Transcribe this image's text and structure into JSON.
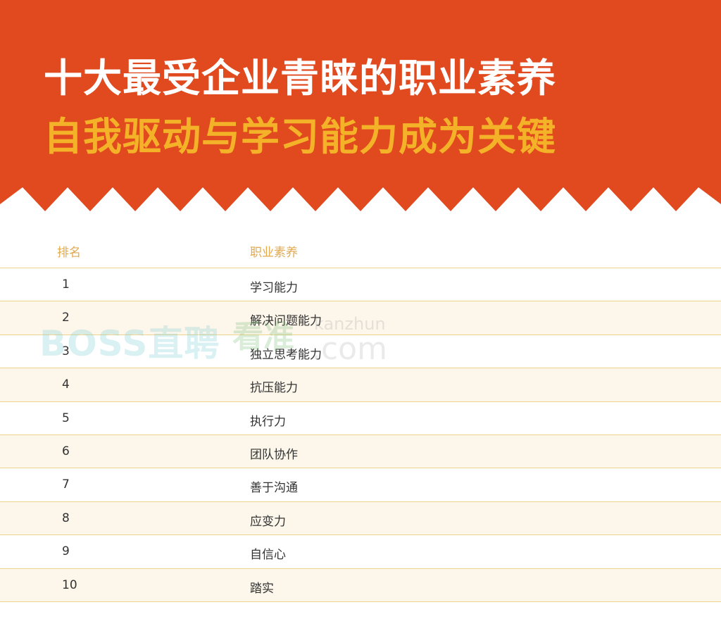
{
  "header": {
    "title_line1": "十大最受企业青睐的职业素养",
    "title_line2": "自我驱动与学习能力成为关键",
    "colors": {
      "banner_bg": "#e14a1f",
      "title_line1": "#ffffff",
      "title_line2": "#f3b228"
    }
  },
  "table": {
    "headers": {
      "rank": "排名",
      "trait": "职业素养"
    },
    "rows": [
      {
        "rank": "1",
        "trait": "学习能力"
      },
      {
        "rank": "2",
        "trait": "解决问题能力"
      },
      {
        "rank": "3",
        "trait": "独立思考能力"
      },
      {
        "rank": "4",
        "trait": "抗压能力"
      },
      {
        "rank": "5",
        "trait": "执行力"
      },
      {
        "rank": "6",
        "trait": "团队协作"
      },
      {
        "rank": "7",
        "trait": "善于沟通"
      },
      {
        "rank": "8",
        "trait": "应变力"
      },
      {
        "rank": "9",
        "trait": "自信心"
      },
      {
        "rank": "10",
        "trait": "踏实"
      }
    ],
    "colors": {
      "header_text": "#e2a94f",
      "row_alt_bg": "#fdf6ea",
      "divider": "#ecd58a",
      "cell_text": "#333333"
    }
  },
  "watermark": {
    "brand": "BOSS直聘",
    "product": "看准",
    "domain_top": "kanzhun",
    "domain_bottom": ".com"
  }
}
